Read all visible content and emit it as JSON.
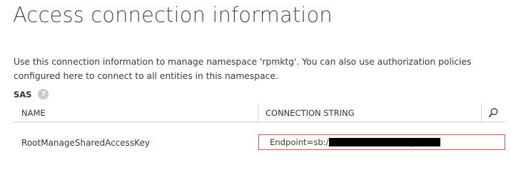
{
  "page": {
    "title": "Access connection information",
    "description": "Use this connection information to manage namespace 'rpmktg'. You can also use authorization policies configured here to connect to all entities in this namespace."
  },
  "sas": {
    "label": "SAS",
    "help_glyph": "?",
    "help_icon": "question-circle-icon"
  },
  "table": {
    "columns": [
      "NAME",
      "CONNECTION STRING"
    ],
    "search_icon": "search-icon",
    "rows": [
      {
        "name": "RootManageSharedAccessKey",
        "connection_string": "Endpoint=sb://r                              /;SharedAccessKey"
      }
    ]
  },
  "colors": {
    "highlight_border": "#d9534f",
    "redaction": "#000000",
    "divider": "#cfcfcf"
  }
}
